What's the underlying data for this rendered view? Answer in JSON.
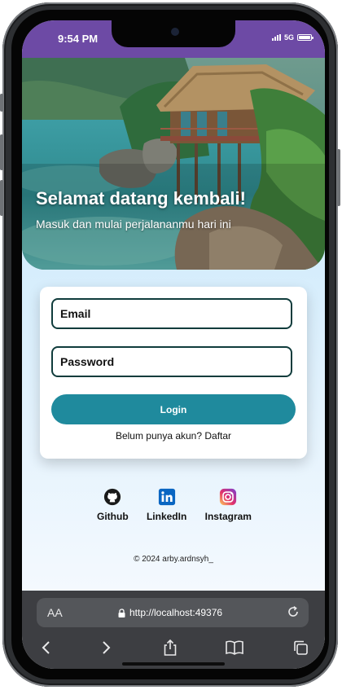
{
  "status": {
    "time": "9:54 PM",
    "network": "5G"
  },
  "hero": {
    "title": "Selamat datang kembali!",
    "subtitle": "Masuk dan mulai perjalananmu hari ini"
  },
  "login_form": {
    "email_placeholder": "Email",
    "password_placeholder": "Password",
    "login_button": "Login",
    "signup_text": "Belum punya akun? Daftar"
  },
  "socials": [
    {
      "label": "Github",
      "icon": "github-icon"
    },
    {
      "label": "LinkedIn",
      "icon": "linkedin-icon"
    },
    {
      "label": "Instagram",
      "icon": "instagram-icon"
    }
  ],
  "footer": {
    "text": "© 2024 arby.ardnsyh_"
  },
  "browser": {
    "text_size_label": "AA",
    "url": "http://localhost:49376"
  },
  "colors": {
    "status_bar": "#6d4aa5",
    "login_button": "#1f8a9d",
    "input_border": "#103c3c",
    "browser_toolbar": "#3d3e42"
  }
}
